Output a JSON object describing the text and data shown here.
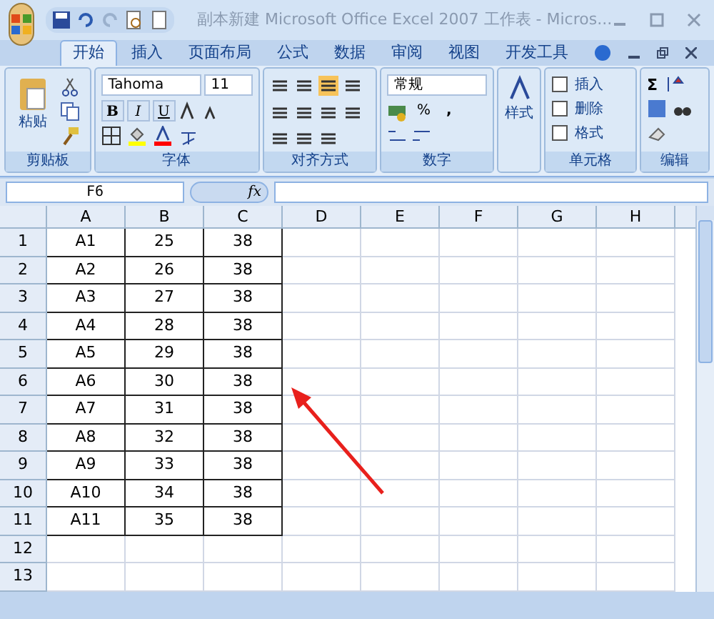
{
  "window": {
    "title": "副本新建 Microsoft Office Excel 2007 工作表 - Micros..."
  },
  "tabs": [
    {
      "label": "开始",
      "selected": true
    },
    {
      "label": "插入",
      "selected": false
    },
    {
      "label": "页面布局",
      "selected": false
    },
    {
      "label": "公式",
      "selected": false
    },
    {
      "label": "数据",
      "selected": false
    },
    {
      "label": "审阅",
      "selected": false
    },
    {
      "label": "视图",
      "selected": false
    },
    {
      "label": "开发工具",
      "selected": false
    }
  ],
  "ribbon": {
    "clipboard": {
      "paste": "粘贴",
      "label": "剪贴板"
    },
    "font": {
      "name": "Tahoma",
      "size": "11",
      "bold": "B",
      "italic": "I",
      "underline": "U",
      "label": "字体"
    },
    "alignment": {
      "label": "对齐方式"
    },
    "number": {
      "format": "常规",
      "percent": "%",
      "comma": ",",
      "label": "数字"
    },
    "styles": {
      "button": "样式"
    },
    "cells": {
      "insert": "插入",
      "delete": "删除",
      "format": "格式",
      "label": "单元格"
    },
    "editing": {
      "sum": "Σ",
      "label": "编辑"
    }
  },
  "name_box": "F6",
  "formula_icon": "fx",
  "sheet": {
    "columns": [
      "A",
      "B",
      "C",
      "D",
      "E",
      "F",
      "G",
      "H"
    ],
    "rows": [
      {
        "header": "1",
        "cells": [
          "A1",
          "25",
          "38"
        ]
      },
      {
        "header": "2",
        "cells": [
          "A2",
          "26",
          "38"
        ]
      },
      {
        "header": "3",
        "cells": [
          "A3",
          "27",
          "38"
        ]
      },
      {
        "header": "4",
        "cells": [
          "A4",
          "28",
          "38"
        ]
      },
      {
        "header": "5",
        "cells": [
          "A5",
          "29",
          "38"
        ]
      },
      {
        "header": "6",
        "cells": [
          "A6",
          "30",
          "38"
        ]
      },
      {
        "header": "7",
        "cells": [
          "A7",
          "31",
          "38"
        ]
      },
      {
        "header": "8",
        "cells": [
          "A8",
          "32",
          "38"
        ]
      },
      {
        "header": "9",
        "cells": [
          "A9",
          "33",
          "38"
        ]
      },
      {
        "header": "10",
        "cells": [
          "A10",
          "34",
          "38"
        ]
      },
      {
        "header": "11",
        "cells": [
          "A11",
          "35",
          "38"
        ]
      },
      {
        "header": "12",
        "cells": []
      },
      {
        "header": "13",
        "cells": []
      }
    ]
  }
}
